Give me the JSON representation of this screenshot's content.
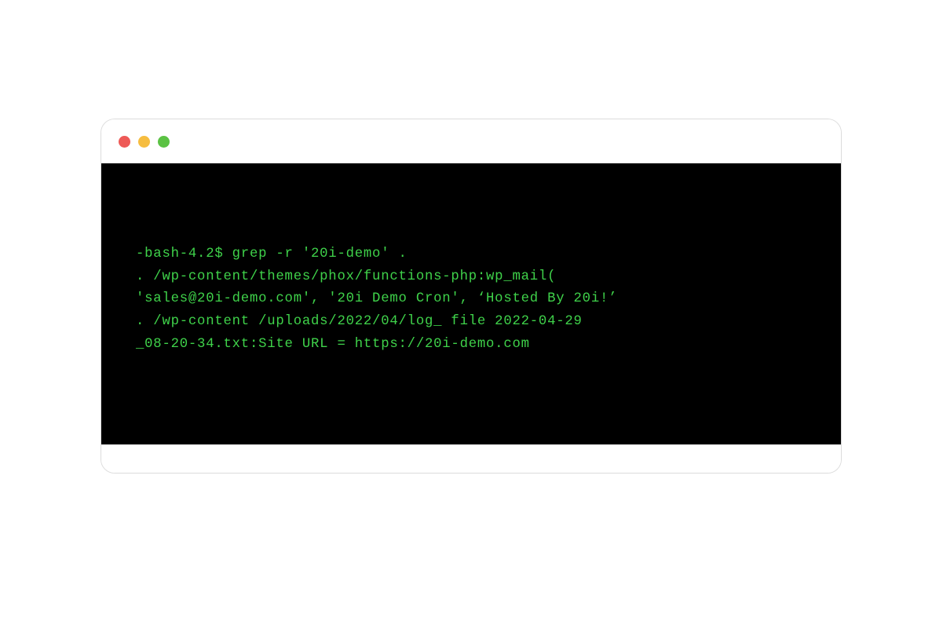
{
  "window": {
    "traffic_lights": {
      "close_color": "#ee5a57",
      "minimize_color": "#f6bd40",
      "zoom_color": "#5bc244"
    }
  },
  "terminal": {
    "text_color": "#3fd24a",
    "background_color": "#000000",
    "lines": {
      "l1": "-bash-4.2$ grep -r '20i-demo' .",
      "l2": ". /wp-content/themes/phox/functions-php:wp_mail(",
      "l3": "'sales@20i-demo.com', '20i Demo Cron', ‘Hosted By 20i!’",
      "l4": "",
      "l5": ". /wp-content /uploads/2022/04/log_ file 2022-04-29",
      "l6": "_08-20-34.txt:Site URL = https://20i-demo.com"
    }
  }
}
